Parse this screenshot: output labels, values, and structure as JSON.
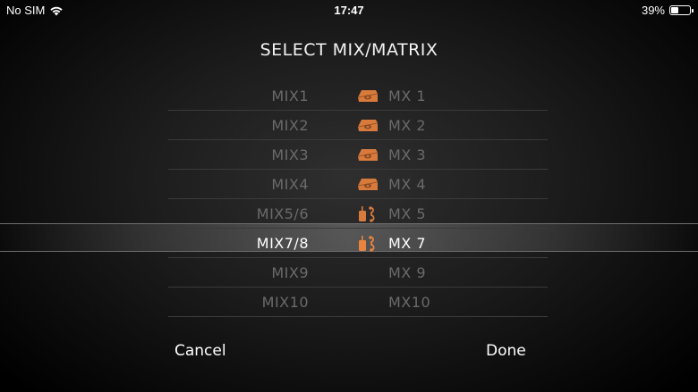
{
  "status_bar": {
    "carrier": "No SIM",
    "wifi_icon": "wifi-icon",
    "time": "17:47",
    "battery_percent": "39%",
    "battery_level": 0.39
  },
  "title": "SELECT MIX/MATRIX",
  "rows": [
    {
      "mix": "MIX1",
      "icon": "wedge-monitor-icon",
      "mx": "MX 1",
      "selected": false
    },
    {
      "mix": "MIX2",
      "icon": "wedge-monitor-icon",
      "mx": "MX 2",
      "selected": false
    },
    {
      "mix": "MIX3",
      "icon": "wedge-monitor-icon",
      "mx": "MX 3",
      "selected": false
    },
    {
      "mix": "MIX4",
      "icon": "wedge-monitor-icon",
      "mx": "MX 4",
      "selected": false
    },
    {
      "mix": "MIX5/6",
      "icon": "in-ear-monitor-icon",
      "mx": "MX 5",
      "selected": false
    },
    {
      "mix": "MIX7/8",
      "icon": "in-ear-monitor-icon",
      "mx": "MX 7",
      "selected": true
    },
    {
      "mix": "MIX9",
      "icon": "",
      "mx": "MX 9",
      "selected": false
    },
    {
      "mix": "MIX10",
      "icon": "",
      "mx": "MX10",
      "selected": false
    }
  ],
  "buttons": {
    "cancel": "Cancel",
    "done": "Done"
  },
  "colors": {
    "icon_orange": "#d77a3c",
    "icon_orange_selected": "#e8843e",
    "dim_text": "#6a6a6a",
    "selected_text": "#ffffff"
  }
}
